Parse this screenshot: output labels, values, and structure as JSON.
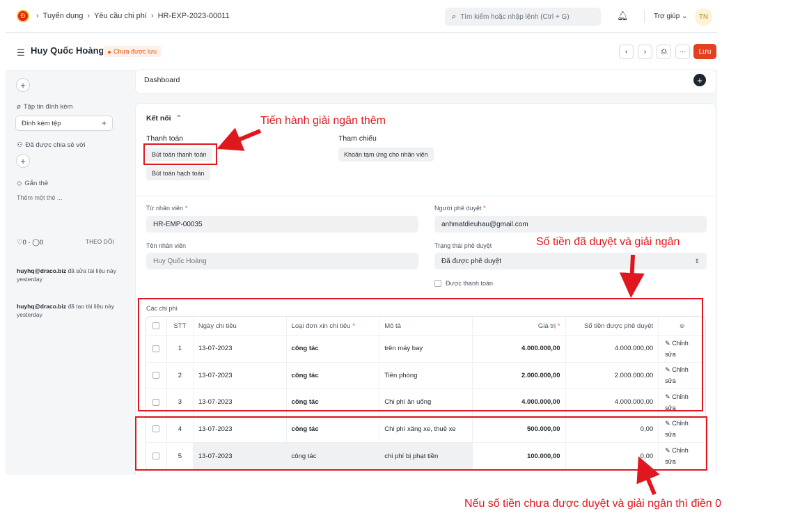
{
  "navbar": {
    "logo_text": "Đ",
    "breadcrumbs": [
      "Tuyển dụng",
      "Yêu cầu chi phí",
      "HR-EXP-2023-00011"
    ],
    "search_placeholder": "Tìm kiếm hoặc nhập lệnh (Ctrl + G)",
    "help_label": "Trợ giúp",
    "avatar_initials": "TN"
  },
  "page_head": {
    "title": "Huy Quốc Hoàng",
    "status_badge": "Chưa được lưu",
    "save_label": "Lưu"
  },
  "sidebar": {
    "attachments_label": "Tập tin đính kèm",
    "attach_button": "Đính kèm tệp",
    "shared_label": "Đã được chia sẻ với",
    "tags_label": "Gắn thẻ",
    "add_tag": "Thêm một thẻ ...",
    "likes": "0",
    "comments": "0",
    "follow_label": "THEO DÕI",
    "activity": [
      {
        "user": "huyhq@draco.biz",
        "text": "đã sửa tài liệu này",
        "time": "yesterday"
      },
      {
        "user": "huyhq@draco.biz",
        "text": "đã tạo tài liệu này",
        "time": "yesterday"
      }
    ]
  },
  "dashboard": {
    "title": "Dashboard"
  },
  "connections": {
    "title": "Kết nối",
    "payment_label": "Thanh toán",
    "payment_items": [
      "Bút toán thanh toán",
      "Bút toán hạch toán"
    ],
    "reference_label": "Tham chiếu",
    "reference_items": [
      "Khoản tạm ứng cho nhân viên"
    ]
  },
  "form": {
    "employee_label": "Từ nhân viên",
    "employee_value": "HR-EMP-00035",
    "approver_label": "Người phê duyệt",
    "approver_value": "anhmatdieuhau@gmail.com",
    "employee_name_label": "Tên nhân viên",
    "employee_name_value": "Huy Quốc Hoàng",
    "approval_status_label": "Trạng thái phê duyệt",
    "approval_status_value": "Đã được phê duyệt",
    "paid_label": "Được thanh toán",
    "required_mark": "*"
  },
  "expenses": {
    "section_label": "Các chi phí",
    "headers": [
      "STT",
      "Ngày chi tiêu",
      "Loại đơn xin chi tiêu",
      "Mô tả",
      "Giá trị",
      "Số tiền được phê duyệt"
    ],
    "edit_label": "Chỉnh sửa",
    "rows": [
      {
        "no": "1",
        "date": "13-07-2023",
        "type": "công tác",
        "desc": "trên máy bay",
        "amount": "4.000.000,00",
        "approved": "4.000.000,00"
      },
      {
        "no": "2",
        "date": "13-07-2023",
        "type": "công tác",
        "desc": "Tiền phòng",
        "amount": "2.000.000,00",
        "approved": "2.000.000,00"
      },
      {
        "no": "3",
        "date": "13-07-2023",
        "type": "công tác",
        "desc": "Chi phí ăn uống",
        "amount": "4.000.000,00",
        "approved": "4.000.000,00"
      },
      {
        "no": "4",
        "date": "13-07-2023",
        "type": "công tác",
        "desc": "Chi phí xăng xe, thuê xe",
        "amount": "500.000,00",
        "approved": "0,00"
      },
      {
        "no": "5",
        "date": "13-07-2023",
        "type": "công tác",
        "desc": "chi phí bị phạt tiền",
        "amount": "100.000,00",
        "approved": "0,00"
      }
    ]
  },
  "annotations": {
    "note_disburse_more": "Tiến hành giải ngân thêm",
    "note_approved": "Số tiền đã duyệt và giải ngân",
    "note_zero": "Nếu số tiền chưa được duyệt và giải ngân thì điền 0",
    "color": "#e0171f"
  }
}
